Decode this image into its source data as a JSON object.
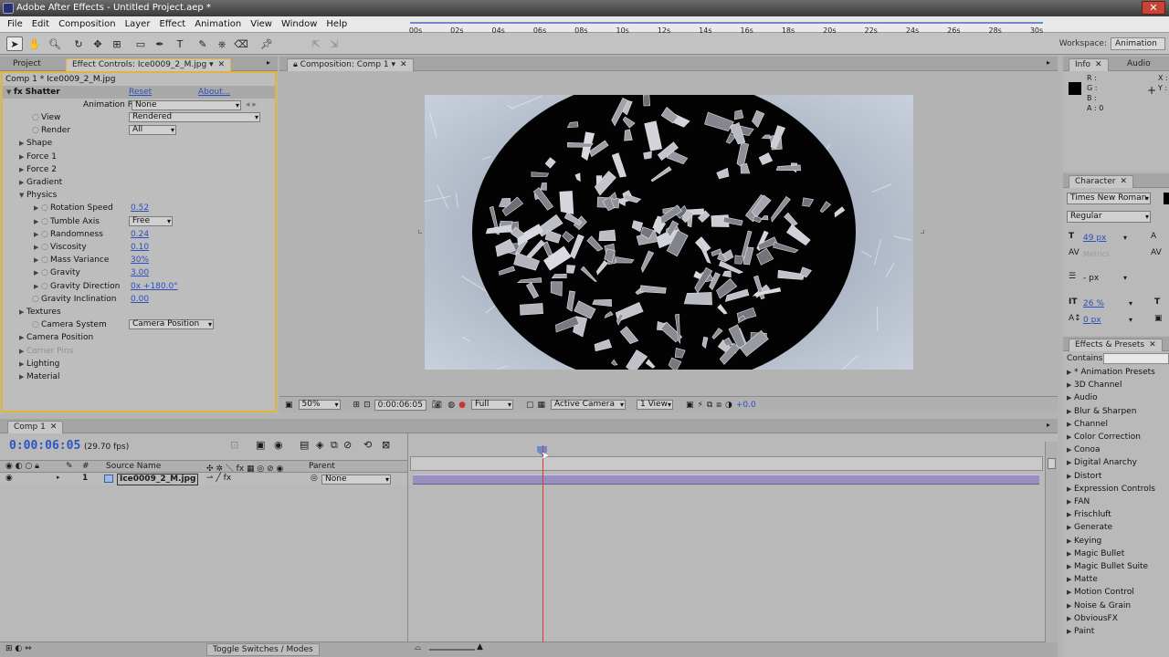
{
  "window": {
    "title": "Adobe After Effects - Untitled Project.aep *",
    "close_glyph": "✕"
  },
  "menu": [
    "File",
    "Edit",
    "Composition",
    "Layer",
    "Effect",
    "Animation",
    "View",
    "Window",
    "Help"
  ],
  "toolbar": {
    "workspace_label": "Workspace:",
    "workspace_value": "Animation"
  },
  "effect_panel": {
    "tabs": {
      "project": "Project",
      "effect_controls": "Effect Controls: Ice0009_2_M.jpg"
    },
    "breadcrumb": "Comp 1 * Ice0009_2_M.jpg",
    "effect_name": "Shatter",
    "reset": "Reset",
    "about": "About...",
    "animation_presets_label": "Animation Presets:",
    "animation_presets_value": "None",
    "properties": [
      {
        "label": "View",
        "value": "Rendered",
        "kind": "dropdown"
      },
      {
        "label": "Render",
        "value": "All",
        "kind": "dropdown"
      },
      {
        "label": "Shape",
        "kind": "group"
      },
      {
        "label": "Force 1",
        "kind": "group"
      },
      {
        "label": "Force 2",
        "kind": "group"
      },
      {
        "label": "Gradient",
        "kind": "group"
      },
      {
        "label": "Physics",
        "kind": "group-open"
      },
      {
        "label": "Rotation Speed",
        "value": "0.52",
        "kind": "value"
      },
      {
        "label": "Tumble Axis",
        "value": "Free",
        "kind": "dropdown"
      },
      {
        "label": "Randomness",
        "value": "0.24",
        "kind": "value"
      },
      {
        "label": "Viscosity",
        "value": "0.10",
        "kind": "value"
      },
      {
        "label": "Mass Variance",
        "value": "30%",
        "kind": "value"
      },
      {
        "label": "Gravity",
        "value": "3.00",
        "kind": "value"
      },
      {
        "label": "Gravity Direction",
        "value": "0x +180.0°",
        "kind": "value"
      },
      {
        "label": "Gravity Inclination",
        "value": "0.00",
        "kind": "value"
      },
      {
        "label": "Textures",
        "kind": "group"
      },
      {
        "label": "Camera System",
        "value": "Camera Position",
        "kind": "dropdown"
      },
      {
        "label": "Camera Position",
        "kind": "group"
      },
      {
        "label": "Corner Pins",
        "kind": "group-disabled"
      },
      {
        "label": "Lighting",
        "kind": "group"
      },
      {
        "label": "Material",
        "kind": "group"
      }
    ]
  },
  "composition": {
    "tab": "Composition: Comp 1",
    "zoom": "50%",
    "timecode": "0:00:06:05",
    "resolution": "Full",
    "camera": "Active Camera",
    "views": "1 View",
    "exposure": "+0.0"
  },
  "info_panel": {
    "tabs": [
      "Info",
      "Audio"
    ],
    "channels": [
      "R :",
      "G :",
      "B :",
      "A : 0"
    ],
    "coords": [
      "X :",
      "Y :"
    ]
  },
  "character_panel": {
    "tab": "Character",
    "font": "Times New Roman",
    "style": "Regular",
    "size": "49 px",
    "leading": "Metrics",
    "stroke": "- px",
    "vert_scale": "26 %",
    "baseline": "0 px"
  },
  "effects_presets": {
    "tab": "Effects & Presets",
    "contains_label": "Contains:",
    "items": [
      "* Animation Presets",
      "3D Channel",
      "Audio",
      "Blur & Sharpen",
      "Channel",
      "Color Correction",
      "Conoa",
      "Digital Anarchy",
      "Distort",
      "Expression Controls",
      "FAN",
      "Frischluft",
      "Generate",
      "Keying",
      "Magic Bullet",
      "Magic Bullet Suite",
      "Matte",
      "Motion Control",
      "Noise & Grain",
      "ObviousFX",
      "Paint"
    ]
  },
  "timeline": {
    "tab": "Comp 1",
    "timecode": "0:00:06:05",
    "fps": "(29.70 fps)",
    "columns": {
      "num": "#",
      "source": "Source Name",
      "parent": "Parent"
    },
    "layer": {
      "index": "1",
      "name": "Ice0009_2_M.jpg",
      "parent": "None"
    },
    "ruler_ticks": [
      "00s",
      "02s",
      "04s",
      "06s",
      "08s",
      "10s",
      "12s",
      "14s",
      "16s",
      "18s",
      "20s",
      "22s",
      "24s",
      "26s",
      "28s",
      "30s"
    ],
    "toggle_label": "Toggle Switches / Modes",
    "playhead_seconds": 6.17
  }
}
